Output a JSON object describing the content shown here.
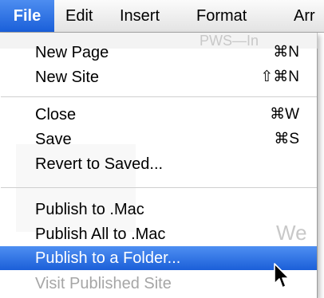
{
  "menubar": {
    "items": [
      {
        "label": "File"
      },
      {
        "label": "Edit"
      },
      {
        "label": "Insert"
      },
      {
        "label": "Format"
      },
      {
        "label": "Arr"
      }
    ]
  },
  "background": {
    "ghost_text_1": "PWS—In",
    "ghost_text_2": "We"
  },
  "file_menu": {
    "new_page": {
      "label": "New Page",
      "shortcut": "⌘N"
    },
    "new_site": {
      "label": "New Site",
      "shortcut": "⇧⌘N"
    },
    "close": {
      "label": "Close",
      "shortcut": "⌘W"
    },
    "save": {
      "label": "Save",
      "shortcut": "⌘S"
    },
    "revert": {
      "label": "Revert to Saved..."
    },
    "publish_mac": {
      "label": "Publish to .Mac"
    },
    "publish_all_mac": {
      "label": "Publish All to .Mac"
    },
    "publish_folder": {
      "label": "Publish to a Folder..."
    },
    "visit_site": {
      "label": "Visit Published Site"
    }
  },
  "colors": {
    "highlight": "#1b5fd8",
    "disabled_text": "#a6a6a6"
  }
}
